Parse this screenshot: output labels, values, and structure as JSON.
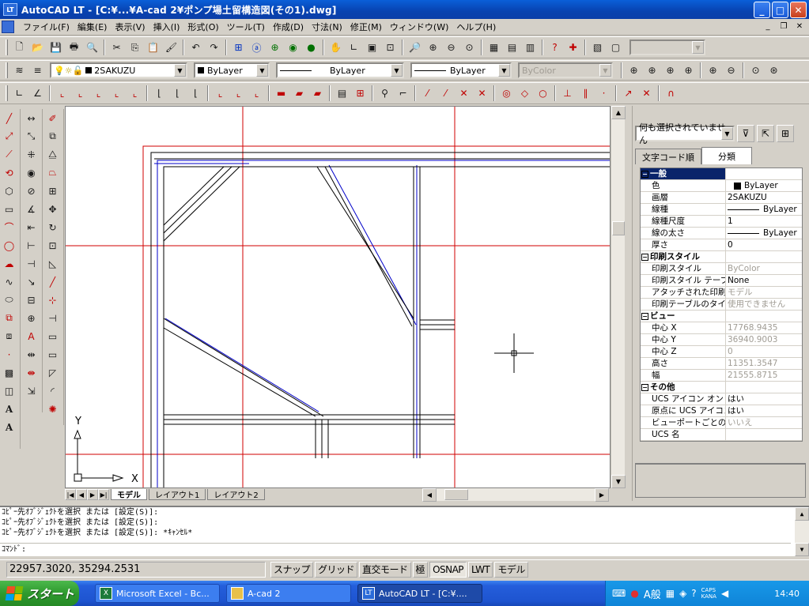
{
  "window": {
    "title": "AutoCAD LT - [C:¥...¥A-cad 2¥ポンプ場土留構造図(その1).dwg]"
  },
  "menu": [
    "ファイル(F)",
    "編集(E)",
    "表示(V)",
    "挿入(I)",
    "形式(O)",
    "ツール(T)",
    "作成(D)",
    "寸法(N)",
    "修正(M)",
    "ウィンドウ(W)",
    "ヘルプ(H)"
  ],
  "layers": {
    "current_layer": "2SAKUZU",
    "color": "ByLayer",
    "linetype": "ByLayer",
    "lineweight": "ByLayer",
    "plotstyle": "ByColor"
  },
  "layout_tabs": [
    "モデル",
    "レイアウト1",
    "レイアウト2"
  ],
  "ucs": {
    "x": "X",
    "y": "Y"
  },
  "properties": {
    "selection": "何も選択されていません",
    "tabs": [
      "文字コード順",
      "分類"
    ],
    "rows": [
      {
        "k": "一般",
        "v": "",
        "cat": true
      },
      {
        "k": "色",
        "v": "ByLayer",
        "kind": "color"
      },
      {
        "k": "画層",
        "v": "2SAKUZU"
      },
      {
        "k": "線種",
        "v": "ByLayer",
        "kind": "line"
      },
      {
        "k": "線種尺度",
        "v": "1"
      },
      {
        "k": "線の太さ",
        "v": "ByLayer",
        "kind": "line"
      },
      {
        "k": "厚さ",
        "v": "0"
      },
      {
        "k": "印刷スタイル",
        "v": "",
        "cat": true
      },
      {
        "k": "印刷スタイル",
        "v": "ByColor",
        "grey": true
      },
      {
        "k": "印刷スタイル テーブル",
        "v": "None"
      },
      {
        "k": "アタッチされた印刷テーブル",
        "v": "モデル",
        "grey": true
      },
      {
        "k": "印刷テーブルのタイプ",
        "v": "使用できません",
        "grey": true
      },
      {
        "k": "ビュー",
        "v": "",
        "cat": true
      },
      {
        "k": "中心 X",
        "v": "17768.9435",
        "grey": true
      },
      {
        "k": "中心 Y",
        "v": "36940.9003",
        "grey": true
      },
      {
        "k": "中心 Z",
        "v": "0",
        "grey": true
      },
      {
        "k": "高さ",
        "v": "11351.3547",
        "grey": true
      },
      {
        "k": "幅",
        "v": "21555.8715",
        "grey": true
      },
      {
        "k": "その他",
        "v": "",
        "cat": true
      },
      {
        "k": "UCS アイコン オン",
        "v": "はい"
      },
      {
        "k": "原点に UCS アイコン",
        "v": "はい"
      },
      {
        "k": "ビューポートごとの UCS",
        "v": "いいえ",
        "grey": true
      },
      {
        "k": "UCS 名",
        "v": ""
      }
    ]
  },
  "command": {
    "history": [
      "ｺﾋﾟｰ先ｵﾌﾞｼﾞｪｸﾄを選択 または [設定(S)]:",
      "ｺﾋﾟｰ先ｵﾌﾞｼﾞｪｸﾄを選択 または [設定(S)]:",
      "ｺﾋﾟｰ先ｵﾌﾞｼﾞｪｸﾄを選択 または [設定(S)]: *ｷｬﾝｾﾙ*"
    ],
    "prompt": "ｺﾏﾝﾄﾞ:"
  },
  "status": {
    "coords": "22957.3020, 35294.2531",
    "toggles": [
      {
        "label": "スナップ",
        "on": false
      },
      {
        "label": "グリッド",
        "on": false
      },
      {
        "label": "直交モード",
        "on": false
      },
      {
        "label": "極",
        "on": false
      },
      {
        "label": "OSNAP",
        "on": true
      },
      {
        "label": "LWT",
        "on": false
      },
      {
        "label": "モデル",
        "on": false
      }
    ]
  },
  "taskbar": {
    "start": "スタート",
    "tasks": [
      "Microsoft Excel - Bc...",
      "A-cad 2",
      "AutoCAD LT - [C:¥...."
    ],
    "ime": "A般",
    "caps": "CAPS",
    "kana": "KANA",
    "clock": "14:40"
  },
  "colors": {
    "red_line": "#d00000",
    "blue_line": "#0000c8",
    "selection": "#0a246a"
  }
}
